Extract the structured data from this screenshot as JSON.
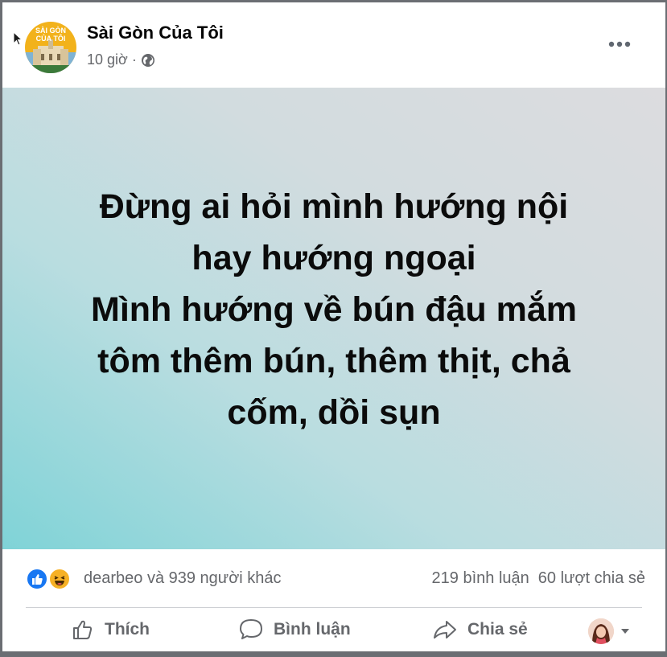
{
  "post": {
    "page_name": "Sài Gòn Của Tôi",
    "time": "10 giờ",
    "separator": "·",
    "avatar_text_line1": "SÀI GÒN",
    "avatar_text_line2": "CỦA TÔI",
    "status_text": "Đừng ai hỏi mình hướng nội\nhay hướng ngoại\nMình hướng về bún đậu mắm\ntôm thêm bún, thêm thịt, chả\ncốm, dồi sụn"
  },
  "reactions": {
    "summary": "dearbeo và 939 người khác",
    "comments": "219 bình luận",
    "shares": "60 lượt chia sẻ",
    "types": [
      "like-icon",
      "haha-icon"
    ]
  },
  "actions": {
    "like": "Thích",
    "comment": "Bình luận",
    "share": "Chia sẻ"
  },
  "colors": {
    "like_blue": "#1877f2",
    "haha_yellow": "#f7b125",
    "secondary_text": "#65676b"
  }
}
